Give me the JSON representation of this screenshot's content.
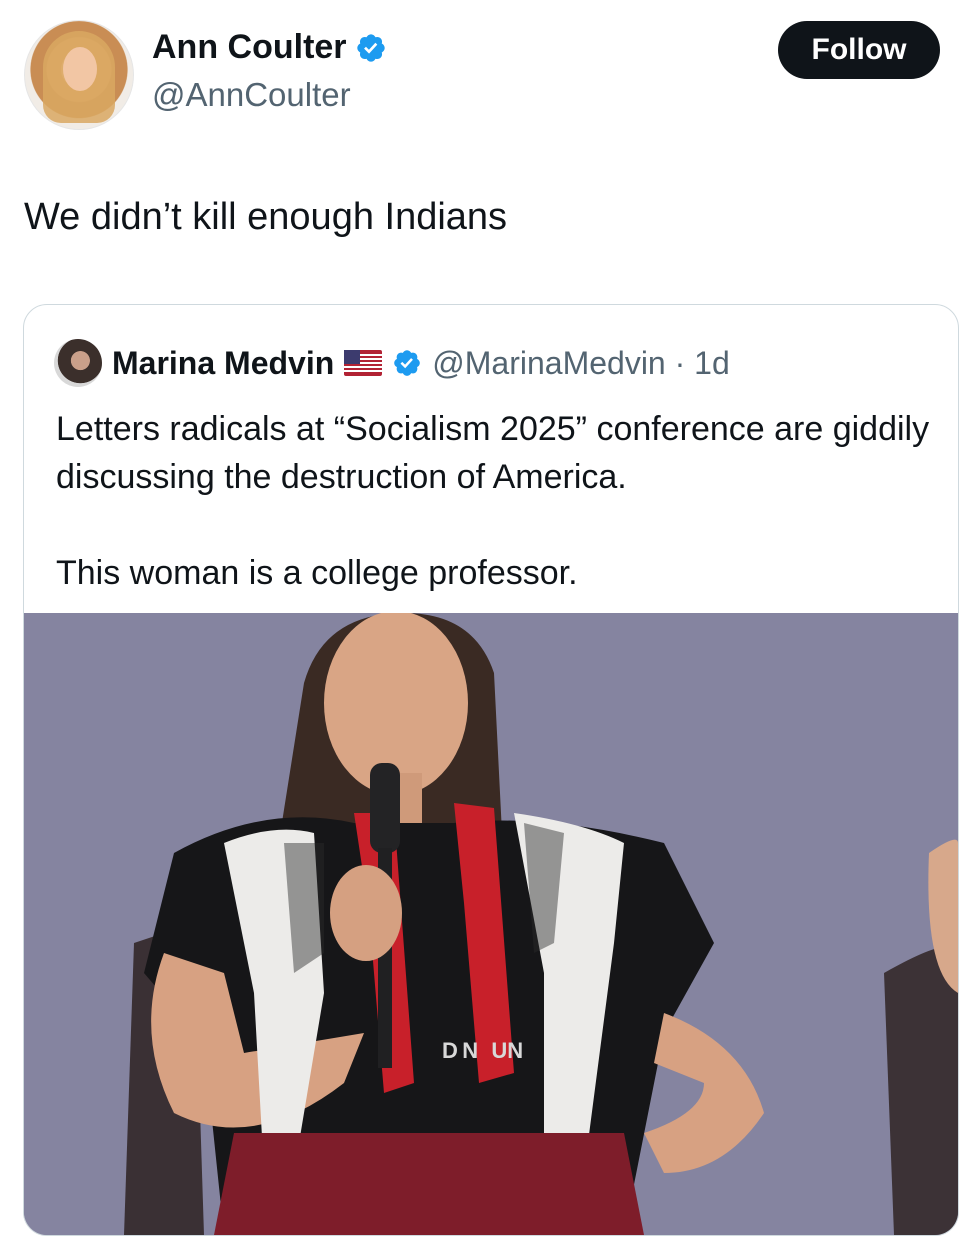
{
  "tweet": {
    "author": {
      "name": "Ann Coulter",
      "handle": "@AnnCoulter",
      "verified": true
    },
    "follow_label": "Follow",
    "text": "We didn’t kill enough Indians"
  },
  "quoted": {
    "author": {
      "name": "Marina Medvin",
      "handle": "@MarinaMedvin",
      "flag": "us-flag-icon",
      "verified": true
    },
    "timestamp": "· 1d",
    "paragraphs": [
      "Letters radicals at “Socialism 2025” conference are giddily discussing the destruction of America.",
      "This woman is a college professor."
    ],
    "image": {
      "shirt_text": "D N   UN"
    }
  },
  "colors": {
    "text_primary": "#0f1419",
    "text_secondary": "#536471",
    "verified_blue": "#1d9bf0",
    "border": "#cfd9de"
  }
}
